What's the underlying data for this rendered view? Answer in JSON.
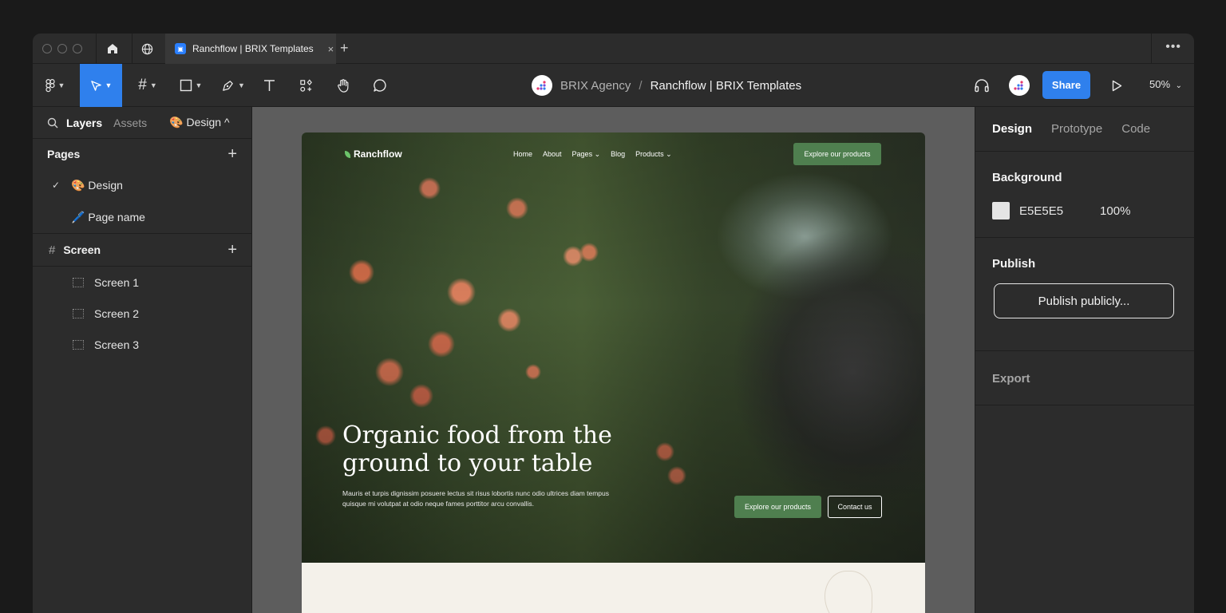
{
  "tab": {
    "title": "Ranchflow | BRIX Templates",
    "close": "×",
    "add": "+"
  },
  "toolbar": {
    "team": "BRIX Agency",
    "separator": "/",
    "file": "Ranchflow | BRIX Templates",
    "share_label": "Share",
    "zoom": "50%"
  },
  "left_panel": {
    "tabs": {
      "layers": "Layers",
      "assets": "Assets",
      "design_page": "🎨 Design ^"
    },
    "pages_title": "Pages",
    "pages": [
      {
        "label": "🎨 Design",
        "selected": true
      },
      {
        "label": "🖊️ Page name",
        "selected": false
      }
    ],
    "frame_title": "Screen",
    "layers": [
      "Screen 1",
      "Screen 2",
      "Screen 3"
    ]
  },
  "site": {
    "logo": "Ranchflow",
    "nav": [
      "Home",
      "About",
      "Pages ⌄",
      "Blog",
      "Products ⌄"
    ],
    "nav_cta": "Explore our products",
    "headline": "Organic food from the ground to your table",
    "paragraph": "Mauris et turpis dignissim posuere lectus sit risus lobortis nunc odio ultrices diam tempus quisque mi volutpat at odio neque fames porttitor arcu convallis.",
    "primary_cta": "Explore our products",
    "secondary_cta": "Contact us"
  },
  "right_panel": {
    "tabs": [
      "Design",
      "Prototype",
      "Code"
    ],
    "background_title": "Background",
    "background_hex": "E5E5E5",
    "background_opacity": "100%",
    "publish_title": "Publish",
    "publish_button": "Publish publicly...",
    "export_title": "Export"
  },
  "colors": {
    "accent": "#2f80ed",
    "site_green": "#4f7f4f",
    "swatch": "#e5e5e5"
  }
}
